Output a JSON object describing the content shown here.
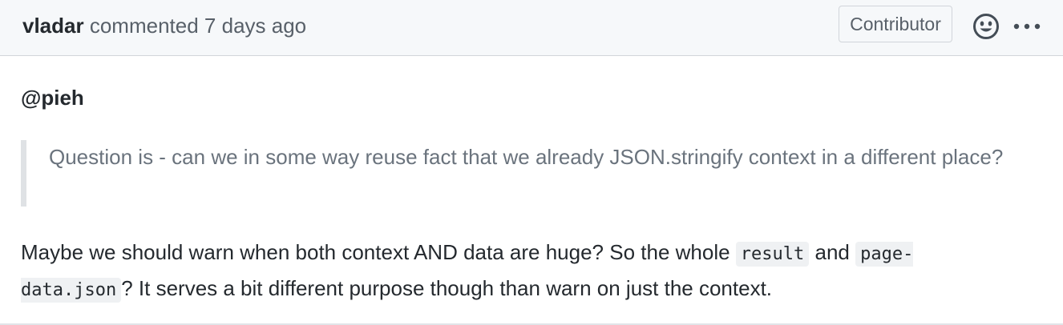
{
  "header": {
    "author": "vladar",
    "action": "commented",
    "time": "7 days ago",
    "badge": "Contributor",
    "reaction_icon": "smiley-icon",
    "more_icon": "kebab-horizontal-icon"
  },
  "body": {
    "mention": "@pieh",
    "quote": "Question is - can we in some way reuse fact that we already JSON.stringify context in a different place?",
    "para_part1": "Maybe we should warn when both context AND data are huge? So the whole ",
    "code1": "result",
    "para_part2": " and ",
    "code2": "page-data.json",
    "para_part3": "? It serves a bit different purpose though than warn on just the context."
  }
}
